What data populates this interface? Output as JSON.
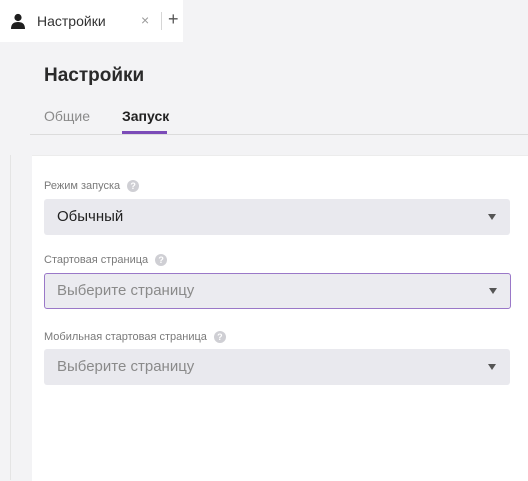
{
  "tab": {
    "title": "Настройки",
    "close_icon": "×",
    "add_icon": "+"
  },
  "page": {
    "title": "Настройки"
  },
  "subtabs": [
    {
      "label": "Общие",
      "active": false
    },
    {
      "label": "Запуск",
      "active": true
    }
  ],
  "fields": {
    "launch_mode": {
      "label": "Режим запуска",
      "value": "Обычный"
    },
    "start_page": {
      "label": "Стартовая страница",
      "placeholder": "Выберите страницу"
    },
    "mobile_start_page": {
      "label": "Мобильная стартовая страница",
      "placeholder": "Выберите страницу"
    }
  },
  "help_glyph": "?",
  "colors": {
    "accent": "#7b4bb8",
    "focus_border": "#9a78c8",
    "select_bg": "#e9e9ee"
  }
}
